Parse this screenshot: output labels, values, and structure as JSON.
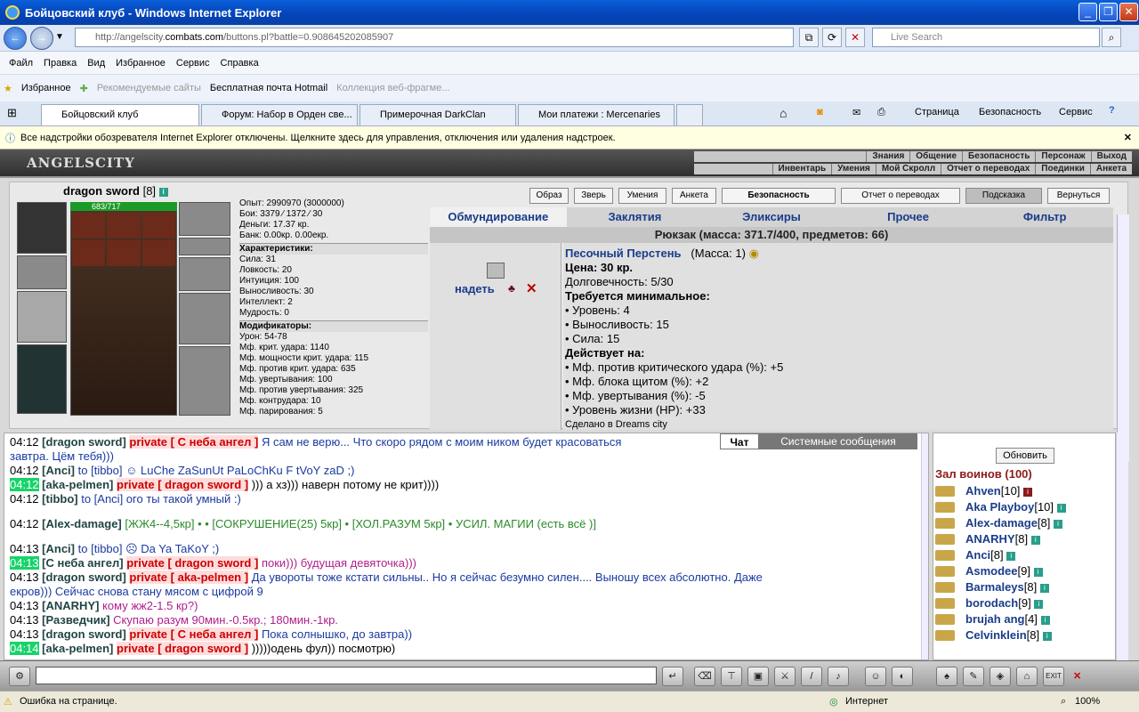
{
  "window": {
    "title": "Бойцовский клуб - Windows Internet Explorer"
  },
  "address": {
    "url_prefix": "http://angelscity.",
    "url_domain": "combats.com",
    "url_rest": "/buttons.pl?battle=0.908645202085907",
    "search_placeholder": "Live Search"
  },
  "menu": [
    "Файл",
    "Правка",
    "Вид",
    "Избранное",
    "Сервис",
    "Справка"
  ],
  "favorites": {
    "label": "Избранное",
    "items": [
      "Рекомендуемые сайты",
      "Бесплатная почта Hotmail",
      "Коллекция веб-фрагме..."
    ]
  },
  "tabs": [
    "Бойцовский клуб",
    "Форум: Набор в Орден све...",
    "Примерочная DarkClan",
    "Мои платежи : Mercenaries"
  ],
  "toolbar_right": [
    "Страница",
    "Безопасность",
    "Сервис"
  ],
  "infobar": "Все надстройки обозревателя Internet Explorer отключены. Щелкните здесь для управления, отключения или удаления надстроек.",
  "game": {
    "logo": "ANGELSCITY",
    "menu_row1": [
      "Знания",
      "Общение",
      "Безопасность",
      "Персонаж",
      "Выход"
    ],
    "menu_row2": [
      "Инвентарь",
      "Умения",
      "Мой Скролл",
      "Отчет о переводах",
      "Поединки",
      "Анкета"
    ],
    "char_name": "dragon sword",
    "char_level": "[8]",
    "hp": "683/717",
    "top_buttons": [
      "Образ",
      "Зверь",
      "Умения",
      "Анкета",
      "Безопасность",
      "Отчет о переводах",
      "Подсказка",
      "Вернуться"
    ],
    "stats": {
      "exp": "Опыт: 2990970 (3000000)",
      "fights": "Бои: 3379 ⁄ 1372 ⁄ 30",
      "money": "Деньги: 17.37 кр.",
      "bank": "Банк: 0.00кр. 0.00екр.",
      "char_header": "Характеристики:",
      "chars": [
        "Сила: 31",
        "Ловкость: 20",
        "Интуиция: 100",
        "Выносливость: 30",
        "Интеллект: 2",
        "Мудрость: 0"
      ],
      "mod_header": "Модификаторы:",
      "mods": [
        "Урон: 54-78",
        "Мф. крит. удара: 1140",
        "Мф. мощности крит. удара: 115",
        "Мф. против крит. удара: 635",
        "Мф. увертывания: 100",
        "Мф. против увертывания: 325",
        "Мф. контрудара: 10",
        "Мф. парирования: 5"
      ]
    },
    "inv_tabs": [
      "Обмундирование",
      "Заклятия",
      "Эликсиры",
      "Прочее",
      "Фильтр"
    ],
    "backpack": "Рюкзак (масса: 371.7/400, предметов: 66)",
    "wear_label": "надеть",
    "item": {
      "name": "Песочный Перстень",
      "mass": "(Масса: 1)",
      "price": "Цена: 30 кр.",
      "durability": "Долговечность: 5/30",
      "req_header": "Требуется минимальное:",
      "reqs": [
        "• Уровень: 4",
        "• Выносливость: 15",
        "• Сила: 15"
      ],
      "acts_header": "Действует на:",
      "acts": [
        "• Мф. против критического удара (%): +5",
        "• Мф. блока щитом (%): +2",
        "• Мф. увертывания (%): -5",
        "• Уровень жизни (HP): +33"
      ],
      "made": "Сделано в Dreams city"
    },
    "chat_tabs": [
      "Чат",
      "Системные сообщения"
    ],
    "chat": [
      {
        "time": "04:12",
        "hl": false,
        "nick": "[dragon sword]",
        "priv": "private [ С неба ангел ]",
        "text": "Я сам не верю... Что скоро рядом с моим ником будет красоваться",
        "cls": "bl"
      },
      {
        "time": "",
        "hl": false,
        "nick": "",
        "priv": "",
        "text": "завтра. Цём тебя)))",
        "cls": "bl"
      },
      {
        "time": "04:12",
        "hl": false,
        "nick": "[Anci]",
        "priv": "",
        "text": "to [tibbo] ☺ LuChe ZaSunUt PaLoChKu F tVoY zaD ;)",
        "cls": "bl"
      },
      {
        "time": "04:12",
        "hl": true,
        "nick": "[aka-pelmen]",
        "priv": "private [ dragon sword ]",
        "text": "))) а хз))) наверн потому не крит))))",
        "cls": "t"
      },
      {
        "time": "04:12",
        "hl": false,
        "nick": "[tibbo]",
        "priv": "",
        "text": "to [Anci] ого ты такой умный :)",
        "cls": "bl"
      },
      {
        "time": "",
        "hl": false,
        "nick": "",
        "priv": "",
        "text": "",
        "cls": "t"
      },
      {
        "time": "04:12",
        "hl": false,
        "nick": "[Alex-damage]",
        "priv": "",
        "text": "[ЖЖ4--4,5кр] • • [СОКРУШЕНИЕ(25) 5кр] • [ХОЛ.РАЗУМ 5кр] • УСИЛ. МАГИИ (есть всё )]",
        "cls": "gr"
      },
      {
        "time": "",
        "hl": false,
        "nick": "",
        "priv": "",
        "text": "",
        "cls": "t"
      },
      {
        "time": "04:13",
        "hl": false,
        "nick": "[Anci]",
        "priv": "",
        "text": "to [tibbo] ☹ Da Ya TaKoY ;)",
        "cls": "bl"
      },
      {
        "time": "04:13",
        "hl": true,
        "nick": "[С неба ангел]",
        "priv": "private [ dragon sword ]",
        "text": "поки))) будущая девяточка)))",
        "cls": "mg"
      },
      {
        "time": "04:13",
        "hl": false,
        "nick": "[dragon sword]",
        "priv": "private [ aka-pelmen ]",
        "text": "Да увороты тоже кстати сильны.. Но я сейчас безумно силен.... Выношу всех абсолютно. Даже",
        "cls": "bl"
      },
      {
        "time": "",
        "hl": false,
        "nick": "",
        "priv": "",
        "text": "екров))) Сейчас снова стану мясом с цифрой 9",
        "cls": "bl"
      },
      {
        "time": "04:13",
        "hl": false,
        "nick": "[ANARHY]",
        "priv": "",
        "text": "кому жж2-1.5 кр?)",
        "cls": "mg"
      },
      {
        "time": "04:13",
        "hl": false,
        "nick": "[Разведчик]",
        "priv": "",
        "text": "Скупаю разум 90мин.-0.5кр.; 180мин.-1кр.",
        "cls": "mg"
      },
      {
        "time": "04:13",
        "hl": false,
        "nick": "[dragon sword]",
        "priv": "private [ С неба ангел ]",
        "text": "Пока солнышко, до завтра))",
        "cls": "bl"
      },
      {
        "time": "04:14",
        "hl": true,
        "nick": "[aka-pelmen]",
        "priv": "private [ dragon sword ]",
        "text": ")))))одень фул)) посмотрю)",
        "cls": "t"
      }
    ],
    "refresh_label": "Обновить",
    "hall": "Зал воинов (100)",
    "users": [
      {
        "name": "Ahven",
        "lvl": "[10]"
      },
      {
        "name": "Aka Playboy",
        "lvl": "[10]"
      },
      {
        "name": "Alex-damage",
        "lvl": "[8]"
      },
      {
        "name": "ANARHY",
        "lvl": "[8]"
      },
      {
        "name": "Anci",
        "lvl": "[8]"
      },
      {
        "name": "Asmodee",
        "lvl": "[9]"
      },
      {
        "name": "Barmaleys",
        "lvl": "[8]"
      },
      {
        "name": "borodach",
        "lvl": "[9]"
      },
      {
        "name": "brujah ang",
        "lvl": "[4]"
      },
      {
        "name": "Celvinklein",
        "lvl": "[8]"
      }
    ],
    "exit_label": "EXIT"
  },
  "status": {
    "text": "Ошибка на странице.",
    "zone": "Интернет",
    "zoom": "100%"
  }
}
